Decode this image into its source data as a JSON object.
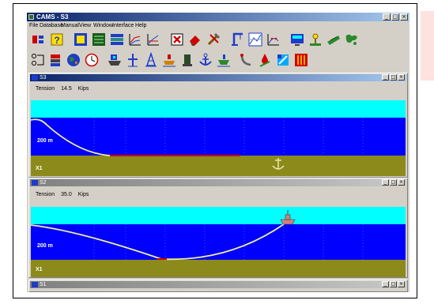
{
  "app": {
    "title": "CAMS - S3",
    "window_buttons": {
      "minimize": "_",
      "restore": "□",
      "close": "×"
    }
  },
  "menu": {
    "items": [
      "File",
      "Database",
      "Manual",
      "View",
      "Window",
      "Interface",
      "Help"
    ]
  },
  "toolbar": {
    "row1_icons": [
      "layout-icon",
      "help-icon",
      "note-icon",
      "list-icon",
      "layers-icon",
      "chart-icon",
      "graph-icon",
      "close-icon",
      "eraser-icon",
      "tools-icon",
      "crane-icon",
      "plot-icon",
      "fit-icon",
      "monitor-icon",
      "wellhead-icon",
      "vessel-icon",
      "map-icon"
    ],
    "row2_icons": [
      "mooring-icon",
      "buoy-icon",
      "globe-icon",
      "clock-icon",
      "ship-icon",
      "mast-icon",
      "rig-icon",
      "platform-icon",
      "winch-icon",
      "anchor-icon",
      "hull-icon",
      "line-icon",
      "drop-icon",
      "flag-icon",
      "meter-icon"
    ]
  },
  "windows": [
    {
      "title": "S3",
      "tension_label": "Tension",
      "tension_value": "14.5",
      "tension_unit": "Kips",
      "depth_label": "200 m",
      "seabed_label": "X1",
      "state": "active"
    },
    {
      "title": "S2",
      "tension_label": "Tension",
      "tension_value": "35.0",
      "tension_unit": "Kips",
      "depth_label": "200 m",
      "seabed_label": "X1",
      "state": "inactive"
    },
    {
      "title": "S1",
      "state": "inactive"
    }
  ],
  "colors": {
    "sky": "#00ffff",
    "sea": "#0000ff",
    "seabed": "#8c8a1a",
    "mooring_line": "#f0f0a0",
    "touchdown": "#d00000",
    "title_active": "#0a246a",
    "title_inactive": "#808080",
    "face": "#d4d0c8"
  }
}
